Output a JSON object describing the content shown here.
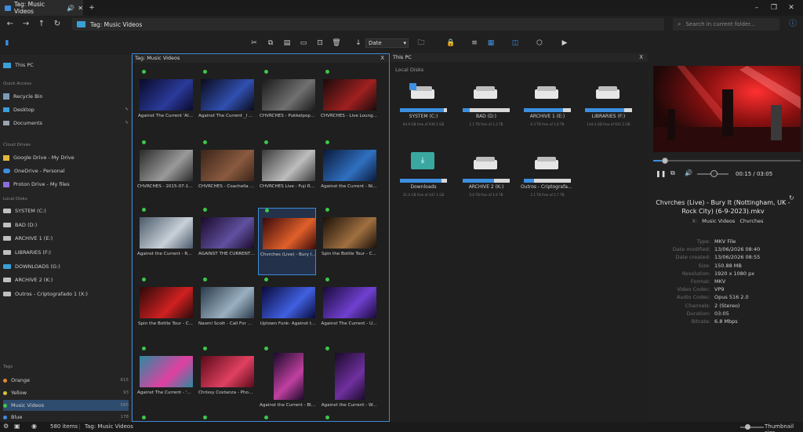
{
  "window": {
    "tab_title": "Tag: Music Videos"
  },
  "address": {
    "path": "Tag: Music Videos",
    "search_placeholder": "Search in current folder..."
  },
  "toolbar": {
    "sort_value": "Date"
  },
  "sidebar": {
    "this_pc": "This PC",
    "quick_access": {
      "header": "Quick Access",
      "items": [
        "Recycle Bin",
        "Desktop",
        "Documents"
      ]
    },
    "cloud": {
      "header": "Cloud Drives",
      "items": [
        "Google Drive - My Drive",
        "OneDrive - Personal",
        "Proton Drive - My files"
      ]
    },
    "local": {
      "header": "Local Disks",
      "items": [
        "SYSTEM (C:)",
        "BAD (D:)",
        "ARCHIVE 1 (E:)",
        "LIBRARIES (F:)",
        "DOWNLOADS (G:)",
        "ARCHIVE 2 (K:)",
        "Outros - Criptografado 1 (X:)"
      ]
    },
    "tags": {
      "header": "Tags",
      "items": [
        {
          "name": "Orange",
          "count": "615",
          "color": "#e08a2c"
        },
        {
          "name": "Yellow",
          "count": "93",
          "color": "#d6c23a"
        },
        {
          "name": "Music Videos",
          "count": "580",
          "color": "#3cc74a"
        },
        {
          "name": "Blue",
          "count": "178",
          "color": "#3d8fe0"
        }
      ]
    }
  },
  "pane1": {
    "title": "Tag: Music Videos",
    "files": [
      "Against The Current 'Al...",
      "Against The Current _I Li...",
      "CHVRCHES - Pukkelpop ...",
      "CHVRCHES - Live Loung...",
      "CHVRCHES - 2015-07-17...",
      "CHVRCHES - Coachella F...",
      "CHVRCHES Live - Fuji Ro...",
      "Against the Current - Ni...",
      "Against the Current - Ro...",
      "AGAINST THE CURRENT ...",
      "Chvrches (Live) - Bury It ...",
      "Spin the Bottle Tour - C...",
      "Spin the Bottle Tour - C...",
      "Naomi Scott - Call For M...",
      "Uptown Funk- Against t...",
      "Against The Current - U...",
      "Against The Current - 'U...",
      "Chrissy Costanza - Phoe...",
      "Against the Current - Bli...",
      "Against the Current - W..."
    ]
  },
  "pane2": {
    "title": "This PC",
    "section": "Local Disks",
    "disks": [
      {
        "name": "SYSTEM (C:)",
        "space": "64.9 GB free of 930.5 GB",
        "used": 0.93
      },
      {
        "name": "BAD (D:)",
        "space": "1.1 TB free of 1.3 TB",
        "used": 0.15
      },
      {
        "name": "ARCHIVE 1 (E:)",
        "space": "0.3 TB free of 1.8 TB",
        "used": 0.83
      },
      {
        "name": "LIBRARIES (F:)",
        "space": "144.4 GB free of 931.5 GB",
        "used": 0.84
      },
      {
        "name": "Downloads",
        "space": "51.0 GB free of 447.1 GB",
        "used": 0.89
      },
      {
        "name": "ARCHIVE 2 (K:)",
        "space": "0.6 TB free of 1.8 TB",
        "used": 0.67
      },
      {
        "name": "Outros - Criptografad...",
        "space": "2.1 TB free of 2.7 TB",
        "used": 0.22
      }
    ]
  },
  "preview": {
    "time": "00:15 / 03:05",
    "progress": 0.08,
    "title": "Chvrches (Live) - Bury It (Nottingham, UK - Rock City) (6-9-2023).mkv",
    "tags": [
      "Music Videos",
      "Chvrches"
    ],
    "props": [
      {
        "k": "Type:",
        "v": "MKV File"
      },
      {
        "k": "Date modified:",
        "v": "13/06/2026 08:40"
      },
      {
        "k": "Date created:",
        "v": "13/06/2026 08:55"
      },
      {
        "k": "Size:",
        "v": "150.88 MB"
      },
      {
        "k": "Resolution:",
        "v": "1920 x 1080 px"
      },
      {
        "k": "Format:",
        "v": "MKV"
      },
      {
        "k": "Video Codec:",
        "v": "VP9"
      },
      {
        "k": "Audio Codec:",
        "v": "Opus 516 2.0"
      },
      {
        "k": "Channels:",
        "v": "2 (Stereo)"
      },
      {
        "k": "Duration:",
        "v": "03:05"
      },
      {
        "k": "Bitrate:",
        "v": "6.8 Mbps"
      }
    ]
  },
  "status": {
    "count": "580 items",
    "location": "Tag: Music Videos",
    "thumb_label": "Thumbnail size"
  }
}
